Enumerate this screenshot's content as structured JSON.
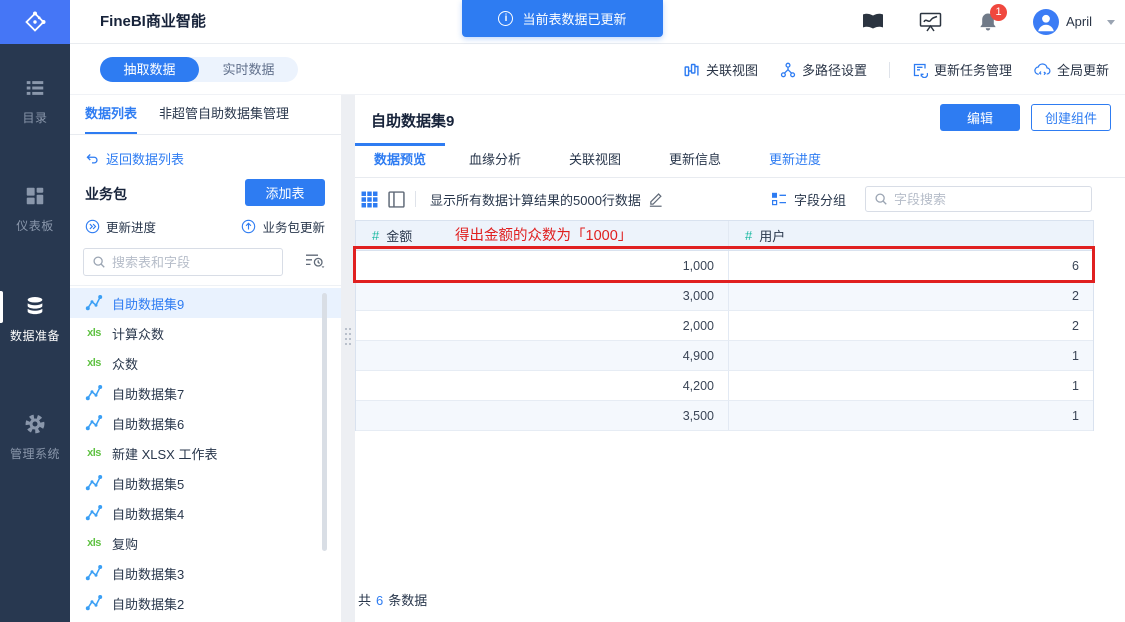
{
  "topbar": {
    "app_title": "FineBI商业智能",
    "notification": "当前表数据已更新",
    "user": {
      "name": "April",
      "badge": "1"
    }
  },
  "nav": {
    "items": [
      {
        "label": "目录"
      },
      {
        "label": "仪表板"
      },
      {
        "label": "数据准备"
      },
      {
        "label": "管理系统"
      }
    ]
  },
  "header_actions": {
    "relation_view": "关联视图",
    "multipath": "多路径设置",
    "update_task": "更新任务管理",
    "global_update": "全局更新"
  },
  "sidebar": {
    "mode": {
      "extract": "抽取数据",
      "realtime": "实时数据"
    },
    "tabs": {
      "data_list": "数据列表",
      "non_admin": "非超管自助数据集管理"
    },
    "back_link": "返回数据列表",
    "package": {
      "title": "业务包",
      "add_button": "添加表",
      "update_progress": "更新进度",
      "package_update": "业务包更新"
    },
    "search_placeholder": "搜索表和字段",
    "datasets": [
      {
        "name": "自助数据集9",
        "type": "dataset"
      },
      {
        "name": "计算众数",
        "type": "xls"
      },
      {
        "name": "众数",
        "type": "xls"
      },
      {
        "name": "自助数据集7",
        "type": "dataset"
      },
      {
        "name": "自助数据集6",
        "type": "dataset"
      },
      {
        "name": "新建 XLSX 工作表",
        "type": "xls"
      },
      {
        "name": "自助数据集5",
        "type": "dataset"
      },
      {
        "name": "自助数据集4",
        "type": "dataset"
      },
      {
        "name": "复购",
        "type": "xls"
      },
      {
        "name": "自助数据集3",
        "type": "dataset"
      },
      {
        "name": "自助数据集2",
        "type": "dataset"
      }
    ]
  },
  "main": {
    "title": "自助数据集9",
    "actions": {
      "edit": "编辑",
      "create": "创建组件"
    },
    "tabs": [
      {
        "label": "数据预览"
      },
      {
        "label": "血缘分析"
      },
      {
        "label": "关联视图"
      },
      {
        "label": "更新信息"
      },
      {
        "label": "更新进度"
      }
    ],
    "toolbar": {
      "row_info": "显示所有数据计算结果的5000行数据",
      "field_group": "字段分组",
      "field_search_placeholder": "字段搜索"
    },
    "annotation": "得出金额的众数为「1000」",
    "table": {
      "hash": "#",
      "columns": [
        "金额",
        "用户"
      ],
      "rows": [
        [
          "1,000",
          "6"
        ],
        [
          "3,000",
          "2"
        ],
        [
          "2,000",
          "2"
        ],
        [
          "4,900",
          "1"
        ],
        [
          "4,200",
          "1"
        ],
        [
          "3,500",
          "1"
        ]
      ]
    },
    "footer": {
      "prefix": "共",
      "count": "6",
      "suffix": "条数据"
    }
  },
  "icons": {
    "xls_label": "xls"
  },
  "colors": {
    "accent": "#2e7cf2",
    "nav_bg": "#283850",
    "logo_bg": "#4576f6",
    "annotation_red": "#e02020",
    "badge_red": "#f0483e",
    "hash_teal": "#18b8a0",
    "xls_green": "#5fc243",
    "selected_row_bg": "#e9f2fe",
    "table_header_bg": "#edf3fb",
    "table_alt_bg": "#f4f8fd"
  }
}
